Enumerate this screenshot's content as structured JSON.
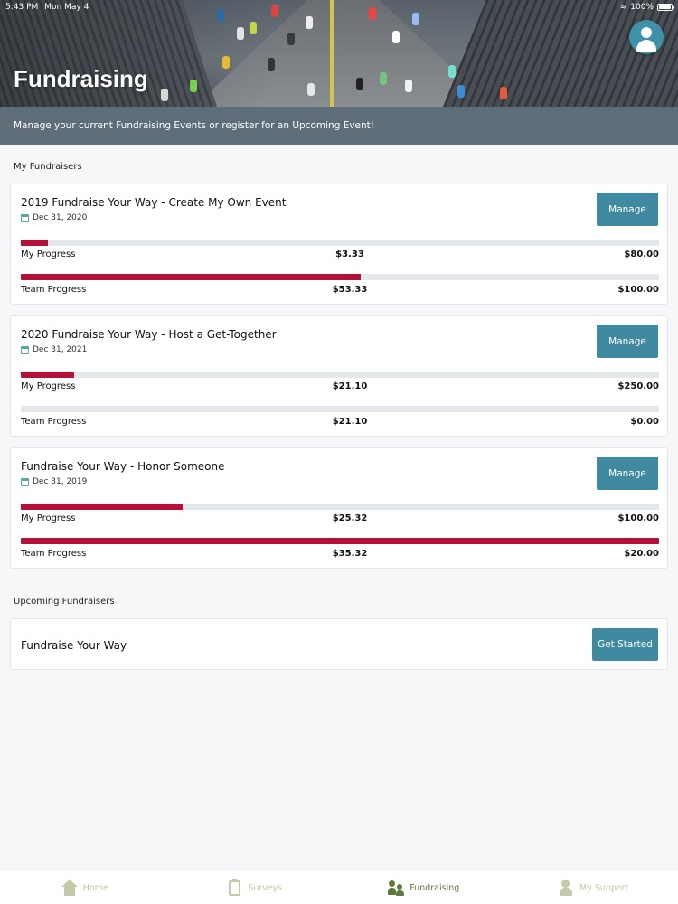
{
  "status_bar": {
    "time": "5:43 PM",
    "date": "Mon May 4",
    "battery": "100%"
  },
  "header": {
    "title": "Fundraising",
    "subtitle": "Manage your current Fundraising Events or register for an Upcoming Event!"
  },
  "my_fundraisers": {
    "title": "My Fundraisers",
    "items": [
      {
        "title": "2019 Fundraise Your Way - Create My Own Event",
        "date": "Dec 31, 2020",
        "button": "Manage",
        "my_progress": {
          "label": "My Progress",
          "current": "$3.33",
          "goal": "$80.00",
          "fraction": 0.042
        },
        "team_progress": {
          "label": "Team Progress",
          "current": "$53.33",
          "goal": "$100.00",
          "fraction": 0.533
        }
      },
      {
        "title": "2020 Fundraise Your Way - Host a Get-Together",
        "date": "Dec 31, 2021",
        "button": "Manage",
        "my_progress": {
          "label": "My Progress",
          "current": "$21.10",
          "goal": "$250.00",
          "fraction": 0.084
        },
        "team_progress": {
          "label": "Team Progress",
          "current": "$21.10",
          "goal": "$0.00",
          "fraction": 0
        }
      },
      {
        "title": "Fundraise Your Way - Honor Someone",
        "date": "Dec 31, 2019",
        "button": "Manage",
        "my_progress": {
          "label": "My Progress",
          "current": "$25.32",
          "goal": "$100.00",
          "fraction": 0.253
        },
        "team_progress": {
          "label": "Team Progress",
          "current": "$35.32",
          "goal": "$20.00",
          "fraction": 1.0
        }
      }
    ]
  },
  "upcoming": {
    "title": "Upcoming Fundraisers",
    "items": [
      {
        "title": "Fundraise Your Way",
        "button": "Get Started"
      }
    ]
  },
  "tabs": [
    {
      "label": "Home",
      "icon": "home-icon"
    },
    {
      "label": "Surveys",
      "icon": "clipboard-icon"
    },
    {
      "label": "Fundraising",
      "icon": "people-icon",
      "active": true
    },
    {
      "label": "My Support",
      "icon": "support-person-icon"
    }
  ],
  "colors": {
    "accent": "#3f8aa1",
    "progress": "#b5103a",
    "banner": "#5e6d78",
    "tab_active": "#5e7a3a"
  }
}
